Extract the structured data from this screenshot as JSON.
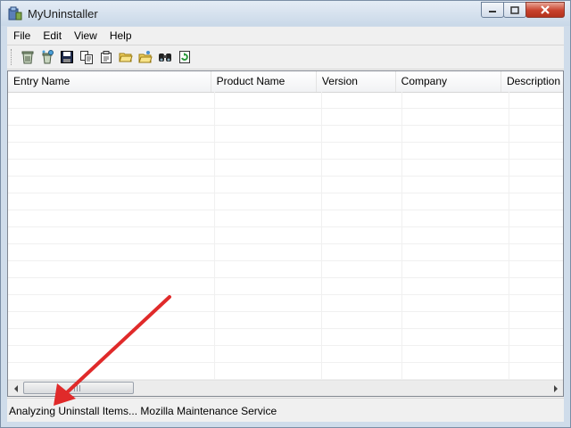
{
  "window": {
    "title": "MyUninstaller"
  },
  "menu": [
    "File",
    "Edit",
    "View",
    "Help"
  ],
  "toolbar": {
    "buttons": [
      {
        "icon": "uninstall-icon"
      },
      {
        "icon": "advanced-uninstall-icon"
      },
      {
        "icon": "save-icon"
      },
      {
        "icon": "copy-icon"
      },
      {
        "icon": "properties-icon"
      },
      {
        "icon": "open-folder-icon"
      },
      {
        "icon": "open-folder-alt-icon"
      },
      {
        "icon": "find-icon"
      },
      {
        "icon": "refresh-icon"
      }
    ]
  },
  "list": {
    "columns": [
      "Entry Name",
      "Product Name",
      "Version",
      "Company",
      "Description"
    ],
    "rows": []
  },
  "status": {
    "text": "Analyzing Uninstall Items... Mozilla Maintenance Service"
  },
  "colors": {
    "annotation_arrow": "#e02a2a"
  }
}
